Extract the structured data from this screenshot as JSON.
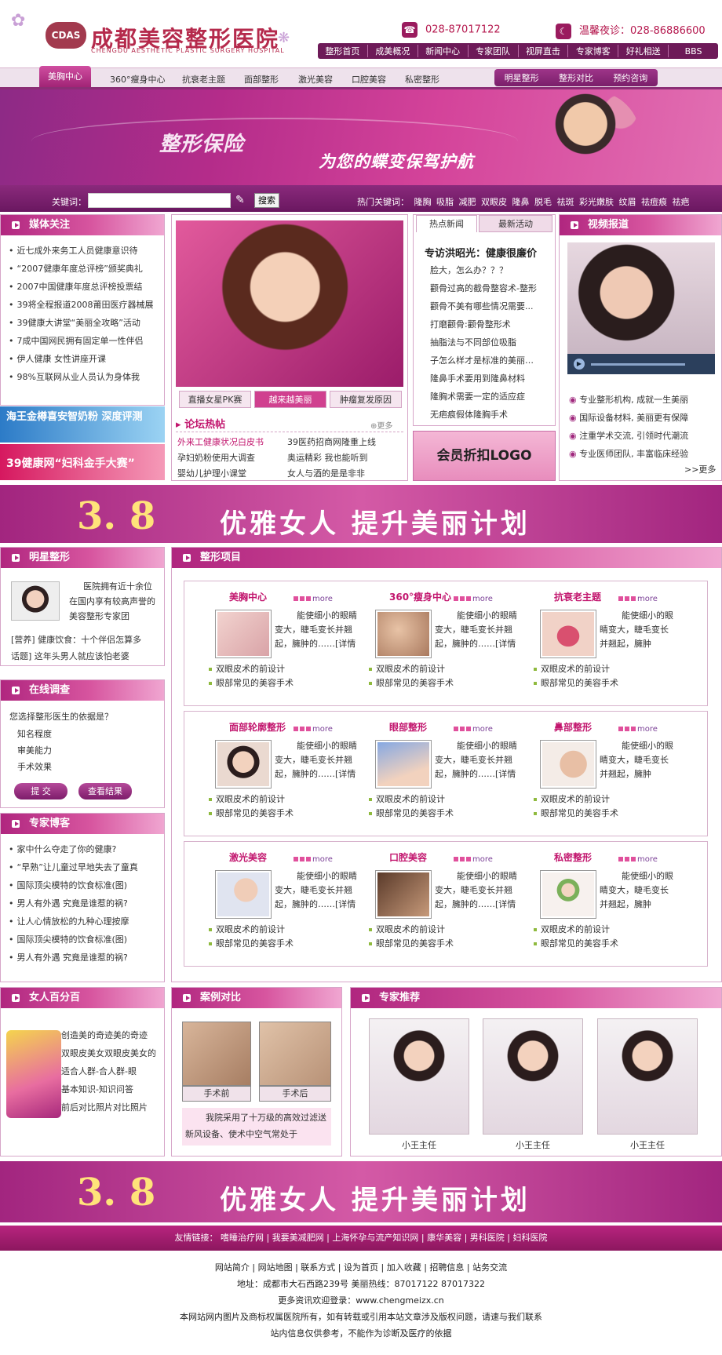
{
  "header": {
    "logo_mark": "CDAS",
    "logo_cn": "成都美容整形医院",
    "logo_en": "CHENGDU AESTHETIC PLASTIC SURGERY HOSPITAL",
    "phone1": "028-87017122",
    "phone2": "温馨夜诊：028-86886600",
    "nav": [
      "整形首页",
      "成美概况",
      "新闻中心",
      "专家团队",
      "视屏直击",
      "专家博客",
      "好礼相送",
      "BBS"
    ]
  },
  "subnav": {
    "active": "美胸中心",
    "items": [
      "360°瘦身中心",
      "抗衰老主题",
      "面部整形",
      "激光美容",
      "口腔美容",
      "私密整形"
    ],
    "right": [
      "明星整形",
      "整形对比",
      "预约咨询"
    ]
  },
  "banner": {
    "t1": "整形保险",
    "t2": "为您的蝶变保驾护航"
  },
  "search": {
    "label": "关键词：",
    "placeholder": "",
    "button": "搜索",
    "hot_label": "热门关键词：",
    "hot": [
      "隆胸",
      "吸脂",
      "减肥",
      "双眼皮",
      "隆鼻",
      "脱毛",
      "祛斑",
      "彩光嫩肤",
      "纹眉",
      "祛痘痕",
      "祛疤"
    ]
  },
  "media": {
    "title": "媒体关注",
    "items": [
      "近七成外来务工人员健康意识待",
      "“2007健康年度总评榜”颁奖典礼",
      "2007中国健康年度总评榜投票结",
      "39将全程报道2008莆田医疗器械展",
      "39健康大讲堂“美丽全攻略”活动",
      "7成中国网民拥有固定单一性伴侣",
      "伊人健康  女性讲座开课",
      "98%互联网从业人员认为身体我"
    ],
    "ad1": "海王金樽喜安智奶粉 深度评测",
    "ad2": "39健康网“妇科金手大赛”"
  },
  "feature": {
    "tabs": [
      "直播女星PK赛",
      "越来越美丽",
      "肿瘤复发原因"
    ],
    "forum_title": "论坛热帖",
    "forum_more": "更多",
    "forum_items": [
      "外来工健康状况白皮书",
      "39医药招商网隆重上线",
      "孕妇奶粉使用大调查",
      "奥运精彩  我也能听到",
      "婴幼儿护理小课堂",
      "女人与酒的是是非非"
    ]
  },
  "news": {
    "tabs": [
      "热点新闻",
      "最新活动"
    ],
    "headline": "专访洪昭光：健康很廉价",
    "items": [
      "脸大，怎么办？？？",
      "颧骨过高的截骨整容术-整形",
      "颧骨不美有哪些情况需要...",
      "打磨颧骨:颧骨整形术",
      "抽脂法与不同部位吸脂",
      "子怎么样才是标准的美丽…",
      "隆鼻手术要用到隆鼻材料",
      "隆胸术需要一定的适应症",
      "无疤痕假体隆胸手术"
    ],
    "member_logo": "会员折扣LOGO"
  },
  "video": {
    "title": "视频报道",
    "items": [
      "专业整形机构, 成就一生美丽",
      "国际设备材料, 美丽更有保障",
      "注重学术交流, 引领时代潮流",
      "专业医师团队, 丰富临床经验"
    ],
    "more": ">>更多"
  },
  "promo": {
    "num": "3. 8",
    "text": "优雅女人  提升美丽计划"
  },
  "star": {
    "title": "明星整形",
    "intro": "医院拥有近十余位在国内享有较高声誉的美容整形专家团",
    "items": [
      "[营养]  健康饮食：十个伴侣怎算多",
      "话题] 这年头男人就应该怕老婆"
    ]
  },
  "survey": {
    "title": "在线调查",
    "question": "您选择整形医生的依据是？",
    "options": [
      "知名程度",
      "审美能力",
      "手术效果"
    ],
    "submit": "提  交",
    "result": "查看结果"
  },
  "blog": {
    "title": "专家博客",
    "items": [
      "家中什么夺走了你的健康?",
      "“早熟”让儿童过早地失去了童真",
      "国际顶尖模特的饮食标准(图)",
      "男人有外遇  究竟是谁惹的祸?",
      "让人心情放松的九种心理按摩",
      "国际顶尖模特的饮食标准(图)",
      "男人有外遇  究竟是谁惹的祸?"
    ]
  },
  "projects": {
    "title": "整形项目",
    "desc": "能使细小的眼睛变大，睫毛变长并翘起，臃肿的……[详情进入]",
    "bullets": [
      "双眼皮术的前设计",
      "眼部常见的美容手术"
    ],
    "more": "more",
    "rows": [
      [
        "美胸中心",
        "360°瘦身中心",
        "抗衰老主题"
      ],
      [
        "面部轮廓整形",
        "眼部整形",
        "鼻部整形"
      ],
      [
        "激光美容",
        "口腔美容",
        "私密整形"
      ]
    ]
  },
  "percent": {
    "title": "女人百分百",
    "items": [
      "创造美的奇迹美的奇迹",
      "双眼皮美女双眼皮美女的",
      "适合人群-合人群-眼",
      "基本知识-知识问答",
      "前后对比照片对比照片"
    ]
  },
  "case": {
    "title": "案例对比",
    "before": "手术前",
    "after": "手术后",
    "text": "我院采用了十万级的高效过滤送新风设备、使术中空气常处于"
  },
  "experts": {
    "title": "专家推荐",
    "names": [
      "小王主任",
      "小王主任",
      "小王主任"
    ]
  },
  "footer": {
    "friends_label": "友情链接：",
    "friends": [
      "嗜睡治疗网",
      "我要美减肥网",
      "上海怀孕与流产知识网",
      "康华美容",
      "男科医院",
      "妇科医院"
    ],
    "links": [
      "网站简介",
      "网站地图",
      "联系方式",
      "设为首页",
      "加入收藏",
      "招聘信息",
      "站务交流"
    ],
    "address": "地址：成都市大石西路239号    美丽热线：87017122    87017322",
    "site": "更多资讯欢迎登录：www.chengmeizx.cn",
    "copyright": "本网站网内图片及商标权属医院所有，如有转载或引用本站文章涉及版权问题，请速与我们联系",
    "disclaimer": "站内信息仅供参考，不能作为诊断及医疗的依据"
  },
  "colors": {
    "brand": "#b52a4c",
    "primary": "#a2257f",
    "nav": "#6d1a58"
  }
}
